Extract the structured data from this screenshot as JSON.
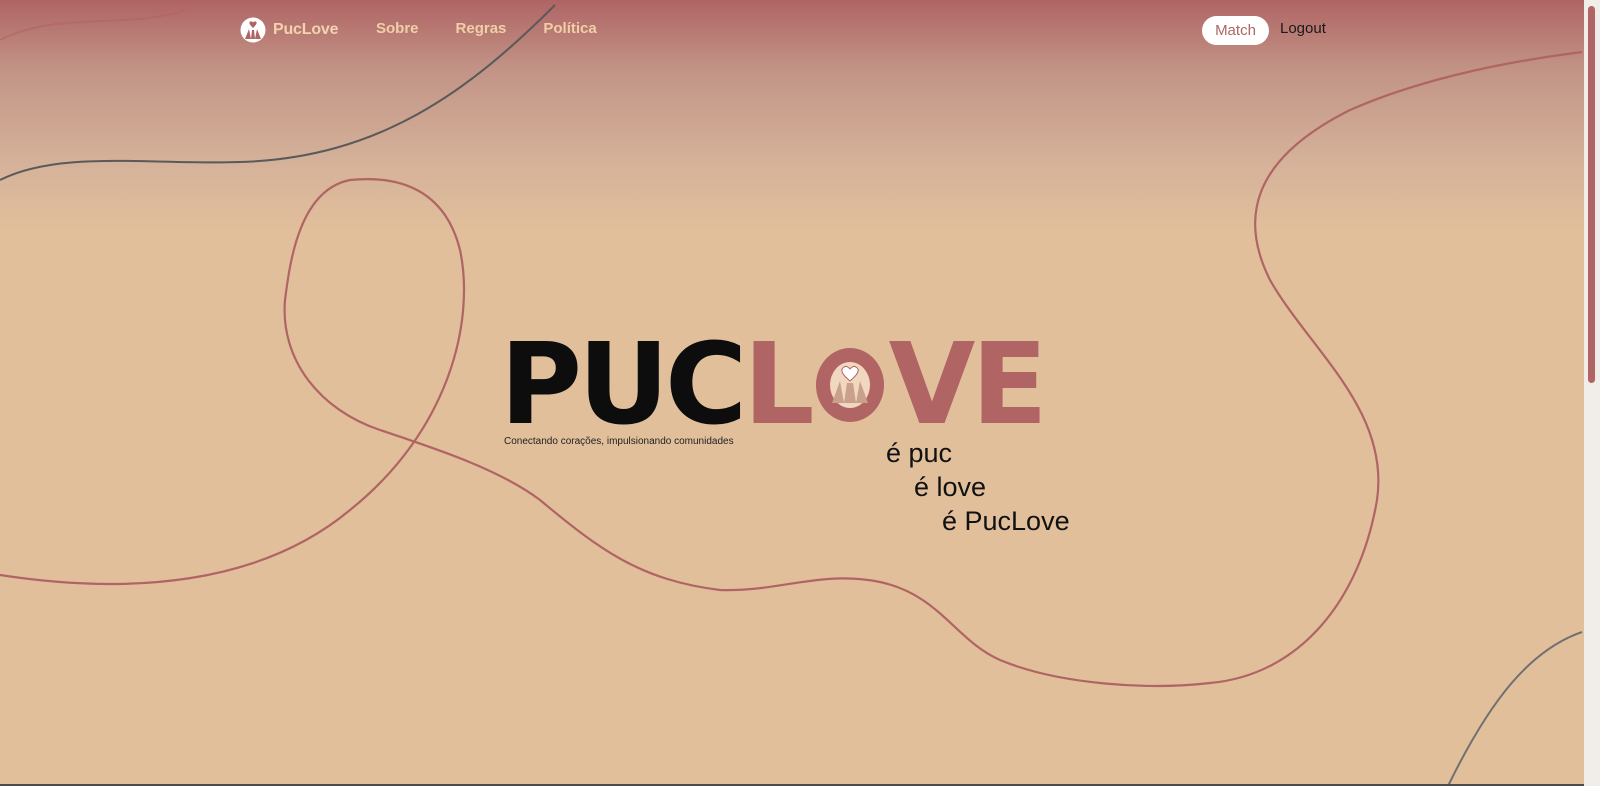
{
  "navbar": {
    "brand_icon": "heart-hands-icon",
    "brand_name": "PucLove",
    "links": [
      {
        "label": "Sobre"
      },
      {
        "label": "Regras"
      },
      {
        "label": "Política"
      }
    ],
    "match_label": "Match",
    "logout_label": "Logout"
  },
  "hero": {
    "logo_part1": "PUC",
    "logo_part2_l": "L",
    "logo_part2_ve": "VE",
    "logo_o_icon": "heart-hands-icon",
    "tagline": "Conectando corações, impulsionando comunidades",
    "slogan": [
      "é puc",
      "é love",
      "é PucLove"
    ]
  },
  "colors": {
    "brand": "#b06464",
    "background": "#e1bf9b",
    "nav_text": "#f0cfa8",
    "curve_dark": "#5a5a5a"
  }
}
